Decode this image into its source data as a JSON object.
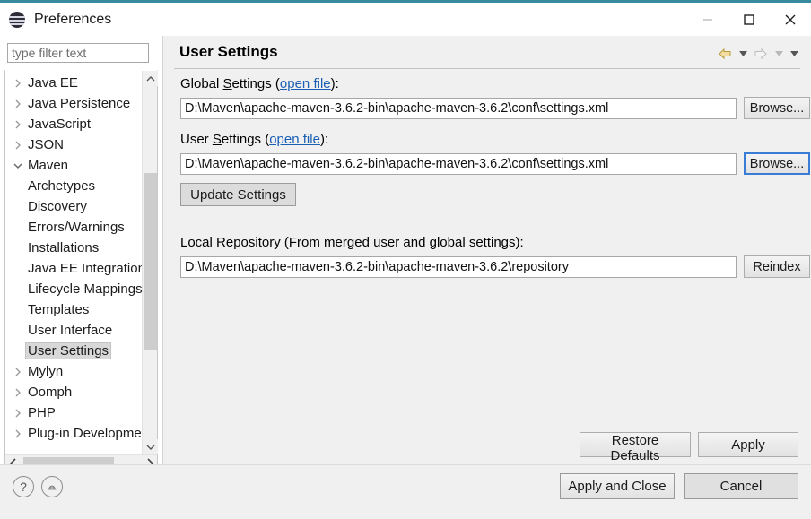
{
  "window": {
    "title": "Preferences",
    "app_icon": "eclipse-icon",
    "controls": {
      "minimize": "minimize-icon",
      "maximize": "maximize-icon",
      "close": "close-icon"
    },
    "accent_color": "#3a8a9e"
  },
  "sidebar": {
    "filter": {
      "placeholder": "type filter text",
      "value": ""
    },
    "items": [
      {
        "label": "Java EE",
        "indent": 0,
        "expandable": true,
        "expanded": false,
        "selected": false
      },
      {
        "label": "Java Persistence",
        "indent": 0,
        "expandable": true,
        "expanded": false,
        "selected": false
      },
      {
        "label": "JavaScript",
        "indent": 0,
        "expandable": true,
        "expanded": false,
        "selected": false
      },
      {
        "label": "JSON",
        "indent": 0,
        "expandable": true,
        "expanded": false,
        "selected": false
      },
      {
        "label": "Maven",
        "indent": 0,
        "expandable": true,
        "expanded": true,
        "selected": false
      },
      {
        "label": "Archetypes",
        "indent": 1,
        "expandable": false,
        "expanded": false,
        "selected": false
      },
      {
        "label": "Discovery",
        "indent": 1,
        "expandable": false,
        "expanded": false,
        "selected": false
      },
      {
        "label": "Errors/Warnings",
        "indent": 1,
        "expandable": false,
        "expanded": false,
        "selected": false
      },
      {
        "label": "Installations",
        "indent": 1,
        "expandable": false,
        "expanded": false,
        "selected": false
      },
      {
        "label": "Java EE Integration",
        "indent": 1,
        "expandable": false,
        "expanded": false,
        "selected": false
      },
      {
        "label": "Lifecycle Mappings",
        "indent": 1,
        "expandable": false,
        "expanded": false,
        "selected": false
      },
      {
        "label": "Templates",
        "indent": 1,
        "expandable": false,
        "expanded": false,
        "selected": false
      },
      {
        "label": "User Interface",
        "indent": 1,
        "expandable": false,
        "expanded": false,
        "selected": false
      },
      {
        "label": "User Settings",
        "indent": 1,
        "expandable": false,
        "expanded": false,
        "selected": true
      },
      {
        "label": "Mylyn",
        "indent": 0,
        "expandable": true,
        "expanded": false,
        "selected": false
      },
      {
        "label": "Oomph",
        "indent": 0,
        "expandable": true,
        "expanded": false,
        "selected": false
      },
      {
        "label": "PHP",
        "indent": 0,
        "expandable": true,
        "expanded": false,
        "selected": false
      },
      {
        "label": "Plug-in Development",
        "indent": 0,
        "expandable": true,
        "expanded": false,
        "selected": false
      }
    ],
    "scrollbars": {
      "vertical_up": "chevron-up-icon",
      "vertical_down": "chevron-down-icon",
      "horizontal_left": "chevron-left-icon",
      "horizontal_right": "chevron-right-icon"
    }
  },
  "page": {
    "title": "User Settings",
    "nav": {
      "back_icon": "back-arrow-icon",
      "back_dropdown_icon": "chevron-down-icon",
      "forward_icon": "forward-arrow-icon",
      "forward_dropdown_icon": "chevron-down-icon",
      "menu_dropdown_icon": "chevron-down-icon"
    },
    "global_settings": {
      "label_prefix": "Global ",
      "label_mnemonic": "S",
      "label_suffix": "ettings (",
      "link": "open file",
      "label_end": "):",
      "value": "D:\\Maven\\apache-maven-3.6.2-bin\\apache-maven-3.6.2\\conf\\settings.xml",
      "browse_label": "Browse..."
    },
    "user_settings": {
      "label_prefix": "User ",
      "label_mnemonic": "S",
      "label_suffix": "ettings (",
      "link": "open file",
      "label_end": "):",
      "value": "D:\\Maven\\apache-maven-3.6.2-bin\\apache-maven-3.6.2\\conf\\settings.xml",
      "browse_label": "Browse..."
    },
    "update_settings_label": "Update Settings",
    "local_repository": {
      "label": "Local Repository (From merged user and global settings):",
      "value": "D:\\Maven\\apache-maven-3.6.2-bin\\apache-maven-3.6.2\\repository",
      "reindex_label": "Reindex"
    },
    "restore_defaults_label": "Restore Defaults",
    "apply_label": "Apply"
  },
  "footer": {
    "help_icon": "question-mark-icon",
    "shell_icon": "oomph-shell-icon",
    "apply_and_close_label": "Apply and Close",
    "cancel_label": "Cancel"
  }
}
